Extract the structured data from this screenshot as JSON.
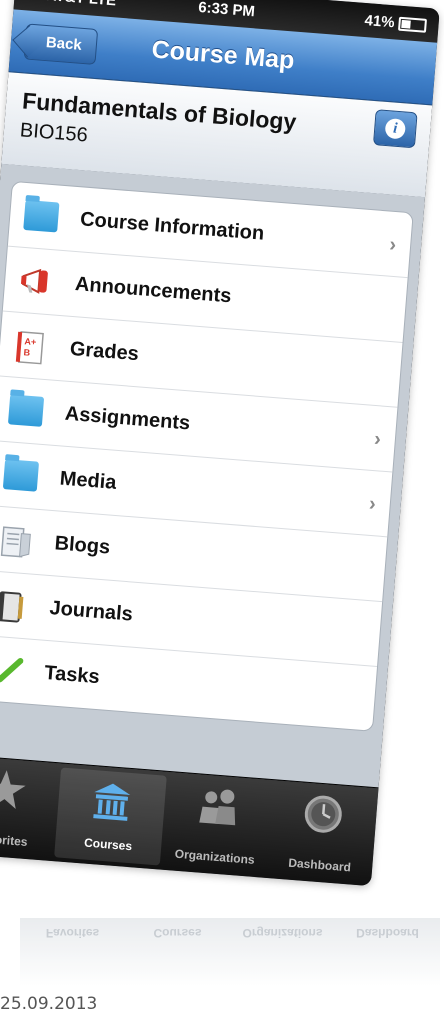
{
  "status_bar": {
    "carrier": "••• AT&T  LTE",
    "time": "6:33 PM",
    "battery": "41%"
  },
  "nav": {
    "back_label": "Back",
    "title": "Course Map",
    "info_label": "i"
  },
  "course": {
    "title": "Fundamentals of Biology",
    "code": "BIO156"
  },
  "menu": [
    {
      "label": "Course Information",
      "icon": "folder-icon",
      "has_chevron": true
    },
    {
      "label": "Announcements",
      "icon": "megaphone-icon",
      "has_chevron": false
    },
    {
      "label": "Grades",
      "icon": "grades-icon",
      "has_chevron": false
    },
    {
      "label": "Assignments",
      "icon": "folder-icon",
      "has_chevron": true
    },
    {
      "label": "Media",
      "icon": "folder-icon",
      "has_chevron": true
    },
    {
      "label": "Blogs",
      "icon": "blogs-icon",
      "has_chevron": false
    },
    {
      "label": "Journals",
      "icon": "journal-icon",
      "has_chevron": false
    },
    {
      "label": "Tasks",
      "icon": "checkmark-icon",
      "has_chevron": false
    }
  ],
  "tabbar": [
    {
      "label": "Favorites",
      "icon": "star-icon",
      "active": false
    },
    {
      "label": "Courses",
      "icon": "courses-building-icon",
      "active": true
    },
    {
      "label": "Organizations",
      "icon": "people-icon",
      "active": false
    },
    {
      "label": "Dashboard",
      "icon": "clock-icon",
      "active": false
    }
  ],
  "date_stamp": "25.09.2013",
  "colors": {
    "nav_blue": "#3f7fc8",
    "list_bg": "#c5ccd4",
    "tabbar": "#1a1a1a"
  }
}
